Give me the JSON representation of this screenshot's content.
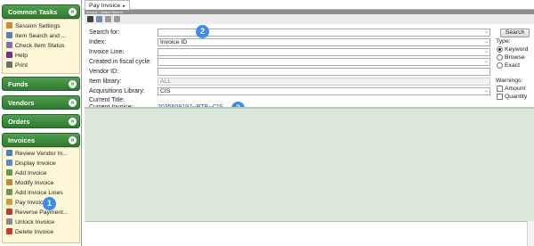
{
  "sidebar": {
    "common_tasks": {
      "title": "Common Tasks",
      "items": [
        "Session Settings",
        "Item Search and ...",
        "Check Item Status",
        "Help",
        "Print"
      ]
    },
    "funds": {
      "title": "Funds"
    },
    "vendors": {
      "title": "Vendors"
    },
    "orders": {
      "title": "Orders"
    },
    "invoices": {
      "title": "Invoices",
      "items": [
        "Review Vendor In...",
        "Display Invoice",
        "Add Invoice",
        "Modify Invoice",
        "Add Invoice Lines",
        "Pay Invoice",
        "Reverse Payment...",
        "Unlock Invoice",
        "Delete Invoice"
      ]
    },
    "toggle_glyph": "»"
  },
  "tab": {
    "label": "Pay Invoice",
    "arrow": "▸"
  },
  "title_strip": "Invoice : Select Search",
  "form": {
    "search_for": {
      "label": "Search for:",
      "value": ""
    },
    "index": {
      "label": "Index:",
      "value": "Invoice ID"
    },
    "invoice_line": {
      "label": "Invoice Line:",
      "value": ""
    },
    "fiscal_cycle": {
      "label": "Created in fiscal cycle:",
      "value": ""
    },
    "vendor_id": {
      "label": "Vendor ID:",
      "value": ""
    },
    "item_library": {
      "label": "Item library:",
      "value": "ALL"
    },
    "acq_library": {
      "label": "Acquisitions Library:",
      "value": "CIS"
    },
    "current_title": {
      "label": "Current Title:",
      "value": ""
    },
    "current_invoice": {
      "label": "Current Invoice:",
      "value": "2035609197--BTB--CIS"
    },
    "dropdown_glyph": "⌄"
  },
  "right_panel": {
    "search_button": "Search",
    "type": {
      "title": "Type:",
      "options": [
        "Keyword",
        "Browse",
        "Exact"
      ],
      "selected": "Keyword"
    },
    "warnings": {
      "title": "Warnings:",
      "options": [
        "Amount",
        "Quantity"
      ]
    }
  },
  "badges": [
    "1",
    "2",
    "2"
  ],
  "colors": {
    "section_green": "#2f7a2f",
    "panel_cream": "#fdf7d7",
    "results_green": "#dde8dd",
    "badge_blue": "#3a8ee6",
    "link_blue": "#1f4fb4"
  },
  "icons": {
    "toolbar": [
      "binoculars-icon",
      "lookup-icon",
      "back-arrow-icon",
      "forward-arrow-icon"
    ]
  }
}
